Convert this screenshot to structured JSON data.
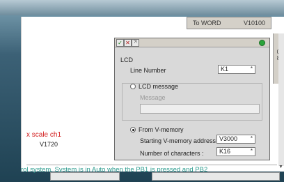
{
  "background": {
    "to_word_label": "To WORD",
    "to_word_value": "V10100",
    "right_strip_chars": [
      "0",
      "8"
    ],
    "red_label": "x scale ch1",
    "memory_label": "V1720",
    "status_text": "rol system. System is in Auto when the PB1 is pressed and PB2"
  },
  "dialog": {
    "toolbar": {
      "ok_glyph": "✓",
      "cancel_glyph": "✕",
      "help_glyph": "?!"
    },
    "title": "LCD",
    "line_number_label": "Line Number",
    "line_number_value": "K1",
    "lcd_message_label": "LCD message",
    "message_label": "Message",
    "message_value": "",
    "from_vmemory_label": "From V-memory",
    "starting_address_label": "Starting V-memory address :",
    "starting_address_value": "V3000",
    "num_chars_label": "Number of characters :",
    "num_chars_value": "K16",
    "star": "*"
  },
  "colors": {
    "accent_red": "#d32020",
    "accent_teal": "#2d9c8e",
    "status_green": "#2aa33a"
  }
}
